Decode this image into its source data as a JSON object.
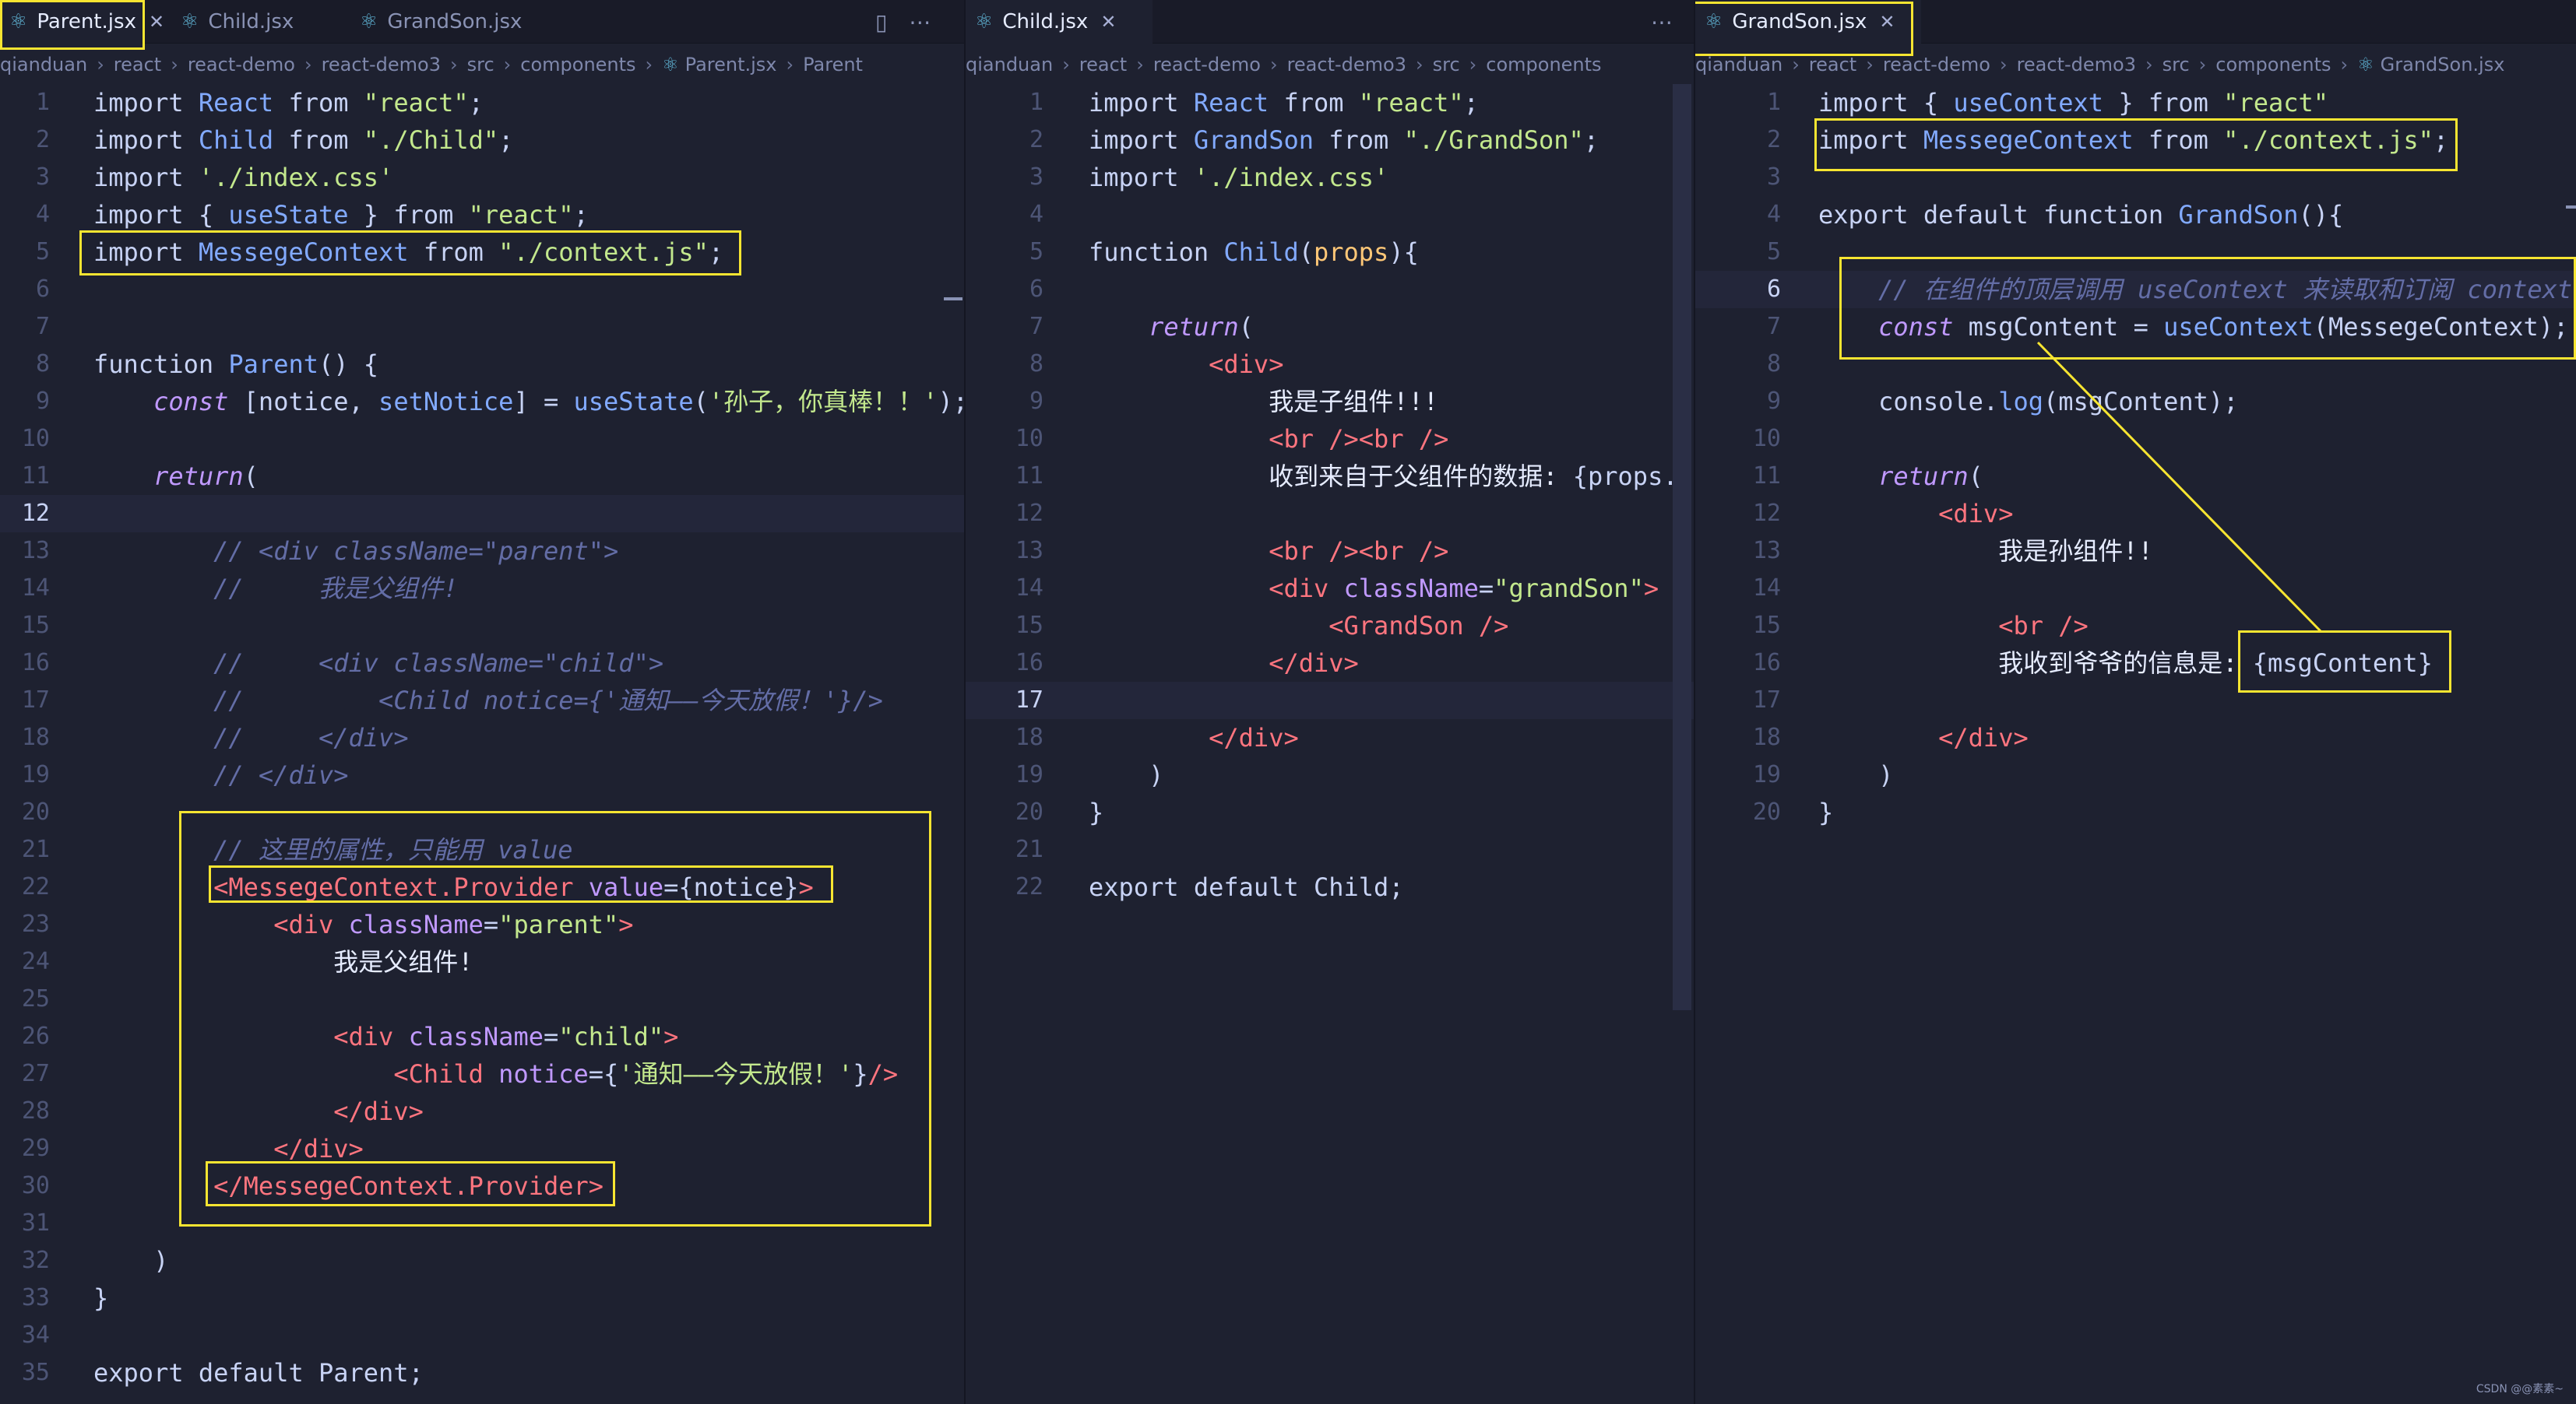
{
  "colors": {
    "highlight": "#f7e531",
    "background": "#1e2130",
    "tag": "#ff757f",
    "string": "#c3e88d",
    "keyword_blue": "#82aaff",
    "comment": "#636da6",
    "attr": "#c099ff"
  },
  "pane1": {
    "tabs": [
      {
        "label": "Parent.jsx",
        "icon": "react-icon"
      },
      {
        "label": "Child.jsx",
        "icon": "react-icon"
      },
      {
        "label": "GrandSon.jsx",
        "icon": "react-icon"
      }
    ],
    "breadcrumb": [
      "qianduan",
      "react",
      "react-demo",
      "react-demo3",
      "src",
      "components",
      "Parent.jsx",
      "Parent"
    ],
    "current_line": 12,
    "lines": [
      [
        [
          "k",
          "import "
        ],
        [
          "b",
          "React "
        ],
        [
          "k",
          "from "
        ],
        [
          "s",
          "\"react\""
        ],
        [
          "k",
          ";"
        ]
      ],
      [
        [
          "k",
          "import "
        ],
        [
          "b",
          "Child "
        ],
        [
          "k",
          "from "
        ],
        [
          "s",
          "\"./Child\""
        ],
        [
          "k",
          ";"
        ]
      ],
      [
        [
          "k",
          "import "
        ],
        [
          "s",
          "'./index.css'"
        ]
      ],
      [
        [
          "k",
          "import "
        ],
        [
          "k",
          "{ "
        ],
        [
          "b",
          "useState"
        ],
        [
          "k",
          " } "
        ],
        [
          "k",
          "from "
        ],
        [
          "s",
          "\"react\""
        ],
        [
          "k",
          ";"
        ]
      ],
      [
        [
          "k",
          "import "
        ],
        [
          "b",
          "MessegeContext "
        ],
        [
          "k",
          "from "
        ],
        [
          "s",
          "\"./context.js\""
        ],
        [
          "k",
          ";"
        ]
      ],
      [],
      [],
      [
        [
          "k",
          "function "
        ],
        [
          "f",
          "Parent"
        ],
        [
          "k",
          "() {"
        ]
      ],
      [
        [
          "k",
          "    "
        ],
        [
          "i",
          "const "
        ],
        [
          "k",
          "[notice, "
        ],
        [
          "f",
          "setNotice"
        ],
        [
          "k",
          "] = "
        ],
        [
          "f",
          "useState"
        ],
        [
          "k",
          "("
        ],
        [
          "s",
          "'孙子，你真棒！！'"
        ],
        [
          "k",
          ");"
        ]
      ],
      [],
      [
        [
          "k",
          "    "
        ],
        [
          "i",
          "return"
        ],
        [
          "k",
          "("
        ]
      ],
      [],
      [
        [
          "c",
          "        // <div className=\"parent\">"
        ]
      ],
      [
        [
          "c",
          "        //     我是父组件!"
        ]
      ],
      [],
      [
        [
          "c",
          "        //     <div className=\"child\">"
        ]
      ],
      [
        [
          "c",
          "        //         <Child notice={'通知——今天放假！'}/>"
        ]
      ],
      [
        [
          "c",
          "        //     </div>"
        ]
      ],
      [
        [
          "c",
          "        // </div>"
        ]
      ],
      [],
      [
        [
          "c",
          "        // 这里的属性，只能用 value"
        ]
      ],
      [
        [
          "k",
          "        "
        ],
        [
          "t",
          "<MessegeContext.Provider "
        ],
        [
          "a",
          "value"
        ],
        [
          "k",
          "="
        ],
        [
          "k",
          "{notice}"
        ],
        [
          "t",
          ">"
        ]
      ],
      [
        [
          "k",
          "            "
        ],
        [
          "t",
          "<div "
        ],
        [
          "a",
          "className"
        ],
        [
          "k",
          "="
        ],
        [
          "s",
          "\"parent\""
        ],
        [
          "t",
          ">"
        ]
      ],
      [
        [
          "w",
          "                我是父组件!"
        ]
      ],
      [],
      [
        [
          "k",
          "                "
        ],
        [
          "t",
          "<div "
        ],
        [
          "a",
          "className"
        ],
        [
          "k",
          "="
        ],
        [
          "s",
          "\"child\""
        ],
        [
          "t",
          ">"
        ]
      ],
      [
        [
          "k",
          "                    "
        ],
        [
          "t",
          "<Child "
        ],
        [
          "a",
          "notice"
        ],
        [
          "k",
          "={"
        ],
        [
          "s",
          "'通知——今天放假！'"
        ],
        [
          "k",
          "}"
        ],
        [
          "t",
          "/>"
        ]
      ],
      [
        [
          "k",
          "                "
        ],
        [
          "t",
          "</div>"
        ]
      ],
      [
        [
          "k",
          "            "
        ],
        [
          "t",
          "</div>"
        ]
      ],
      [
        [
          "k",
          "        "
        ],
        [
          "t",
          "</MessegeContext.Provider>"
        ]
      ],
      [],
      [
        [
          "k",
          "    )"
        ]
      ],
      [
        [
          "k",
          "}"
        ]
      ],
      [],
      [
        [
          "k",
          "export "
        ],
        [
          "k",
          "default "
        ],
        [
          "k",
          "Parent;"
        ]
      ]
    ]
  },
  "pane2": {
    "tabs": [
      {
        "label": "Child.jsx",
        "icon": "react-icon"
      }
    ],
    "breadcrumb": [
      "qianduan",
      "react",
      "react-demo",
      "react-demo3",
      "src",
      "components"
    ],
    "current_line": 17,
    "lines": [
      [
        [
          "k",
          "import "
        ],
        [
          "b",
          "React "
        ],
        [
          "k",
          "from "
        ],
        [
          "s",
          "\"react\""
        ],
        [
          "k",
          ";"
        ]
      ],
      [
        [
          "k",
          "import "
        ],
        [
          "b",
          "GrandSon "
        ],
        [
          "k",
          "from "
        ],
        [
          "s",
          "\"./GrandSon\""
        ],
        [
          "k",
          ";"
        ]
      ],
      [
        [
          "k",
          "import "
        ],
        [
          "s",
          "'./index.css'"
        ]
      ],
      [],
      [
        [
          "k",
          "function "
        ],
        [
          "f",
          "Child"
        ],
        [
          "k",
          "("
        ],
        [
          "y",
          "props"
        ],
        [
          "k",
          "){"
        ]
      ],
      [],
      [
        [
          "k",
          "    "
        ],
        [
          "i",
          "return"
        ],
        [
          "k",
          "("
        ]
      ],
      [
        [
          "k",
          "        "
        ],
        [
          "t",
          "<div>"
        ]
      ],
      [
        [
          "w",
          "            我是子组件!!!"
        ]
      ],
      [
        [
          "k",
          "            "
        ],
        [
          "t",
          "<br /><br />"
        ]
      ],
      [
        [
          "w",
          "            收到来自于父组件的数据: "
        ],
        [
          "k",
          "{props.notice}"
        ]
      ],
      [],
      [
        [
          "k",
          "            "
        ],
        [
          "t",
          "<br /><br />"
        ]
      ],
      [
        [
          "k",
          "            "
        ],
        [
          "t",
          "<div "
        ],
        [
          "a",
          "className"
        ],
        [
          "k",
          "="
        ],
        [
          "s",
          "\"grandSon\""
        ],
        [
          "t",
          ">"
        ]
      ],
      [
        [
          "k",
          "                "
        ],
        [
          "t",
          "<GrandSon />"
        ]
      ],
      [
        [
          "k",
          "            "
        ],
        [
          "t",
          "</div>"
        ]
      ],
      [],
      [
        [
          "k",
          "        "
        ],
        [
          "t",
          "</div>"
        ]
      ],
      [
        [
          "k",
          "    )"
        ]
      ],
      [
        [
          "k",
          "}"
        ]
      ],
      [],
      [
        [
          "k",
          "export "
        ],
        [
          "k",
          "default "
        ],
        [
          "k",
          "Child;"
        ]
      ]
    ]
  },
  "pane3": {
    "tabs": [
      {
        "label": "GrandSon.jsx",
        "icon": "react-icon"
      }
    ],
    "breadcrumb": [
      "qianduan",
      "react",
      "react-demo",
      "react-demo3",
      "src",
      "components",
      "GrandSon.jsx"
    ],
    "current_line": 6,
    "lines": [
      [
        [
          "k",
          "import "
        ],
        [
          "k",
          "{ "
        ],
        [
          "b",
          "useContext"
        ],
        [
          "k",
          " } "
        ],
        [
          "k",
          "from "
        ],
        [
          "s",
          "\"react\""
        ]
      ],
      [
        [
          "k",
          "import "
        ],
        [
          "b",
          "MessegeContext "
        ],
        [
          "k",
          "from "
        ],
        [
          "s",
          "\"./context.js\""
        ],
        [
          "k",
          ";"
        ]
      ],
      [],
      [
        [
          "k",
          "export "
        ],
        [
          "k",
          "default "
        ],
        [
          "k",
          "function "
        ],
        [
          "f",
          "GrandSon"
        ],
        [
          "k",
          "(){"
        ]
      ],
      [],
      [
        [
          "c",
          "    // 在组件的顶层调用 useContext 来读取和订阅 context"
        ]
      ],
      [
        [
          "k",
          "    "
        ],
        [
          "i",
          "const "
        ],
        [
          "k",
          "msgContent = "
        ],
        [
          "f",
          "useContext"
        ],
        [
          "k",
          "(MessegeContext);"
        ]
      ],
      [],
      [
        [
          "k",
          "    console."
        ],
        [
          "f",
          "log"
        ],
        [
          "k",
          "(msgContent);"
        ]
      ],
      [],
      [
        [
          "k",
          "    "
        ],
        [
          "i",
          "return"
        ],
        [
          "k",
          "("
        ]
      ],
      [
        [
          "k",
          "        "
        ],
        [
          "t",
          "<div>"
        ]
      ],
      [
        [
          "w",
          "            我是孙组件!!"
        ]
      ],
      [],
      [
        [
          "k",
          "            "
        ],
        [
          "t",
          "<br />"
        ]
      ],
      [
        [
          "w",
          "            我收到爷爷的信息是: "
        ],
        [
          "k",
          "{msgContent}"
        ]
      ],
      [],
      [
        [
          "k",
          "        "
        ],
        [
          "t",
          "</div>"
        ]
      ],
      [
        [
          "k",
          "    )"
        ]
      ],
      [
        [
          "k",
          "}"
        ]
      ]
    ]
  },
  "watermark": "CSDN @@素素~"
}
